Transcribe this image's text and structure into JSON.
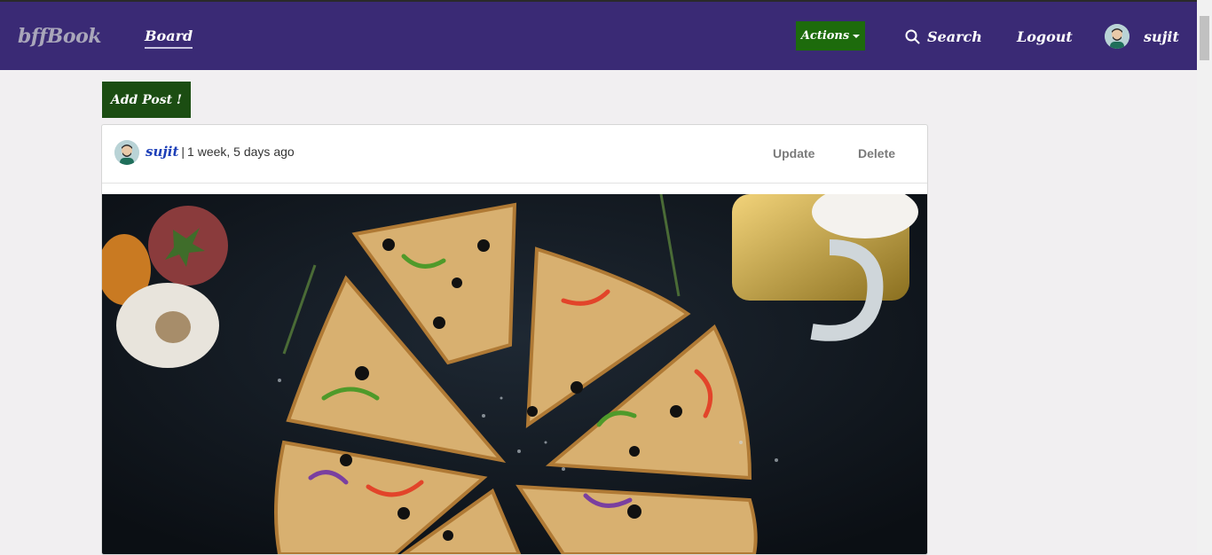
{
  "nav": {
    "brand": "bffBook",
    "board": "Board",
    "actions": "Actions",
    "search": "Search",
    "logout": "Logout",
    "username": "sujit"
  },
  "main": {
    "add_post": "Add Post !"
  },
  "post": {
    "author": "sujit",
    "separator": "|",
    "time": "1 week, 5 days ago",
    "update": "Update",
    "delete": "Delete"
  },
  "colors": {
    "navbar": "#3a2a75",
    "actions_button": "#1d6b0c",
    "add_post_button": "#1b4d12",
    "author_link": "#1d3fb8"
  },
  "icons": {
    "search": "search-icon",
    "caret": "chevron-down-icon"
  }
}
